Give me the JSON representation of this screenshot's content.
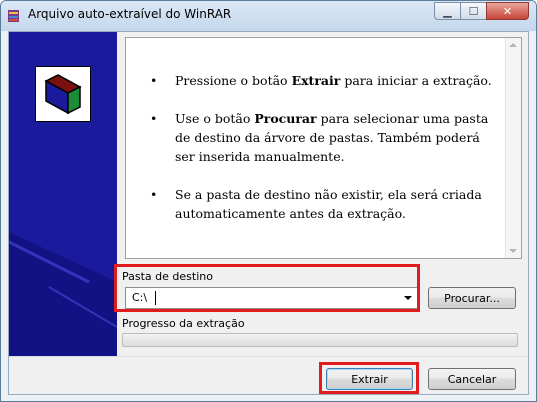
{
  "window": {
    "title": "Arquivo auto-extraível do WinRAR"
  },
  "titlebar_buttons": {
    "minimize_icon": "minimize-icon",
    "maximize_icon": "maximize-icon",
    "close_icon": "close-icon"
  },
  "info": {
    "items": [
      {
        "prefix": "Pressione o botão ",
        "bold": "Extrair",
        "suffix": " para iniciar a extração."
      },
      {
        "prefix": "Use o botão ",
        "bold": "Procurar",
        "suffix": " para selecionar uma pasta de destino da árvore de pastas. Também poderá ser inserida manualmente."
      },
      {
        "prefix": "Se a pasta de destino não existir, ela será criada automaticamente antes da extração.",
        "bold": "",
        "suffix": ""
      }
    ]
  },
  "destination": {
    "label": "Pasta de destino",
    "value": "C:\\",
    "browse_label": "Procurar..."
  },
  "progress": {
    "label": "Progresso da extração",
    "fraction": 0
  },
  "footer": {
    "extract_label": "Extrair",
    "cancel_label": "Cancelar"
  },
  "colors": {
    "highlight": "#e01c1c",
    "panel_blue": "#1a1a9c"
  }
}
